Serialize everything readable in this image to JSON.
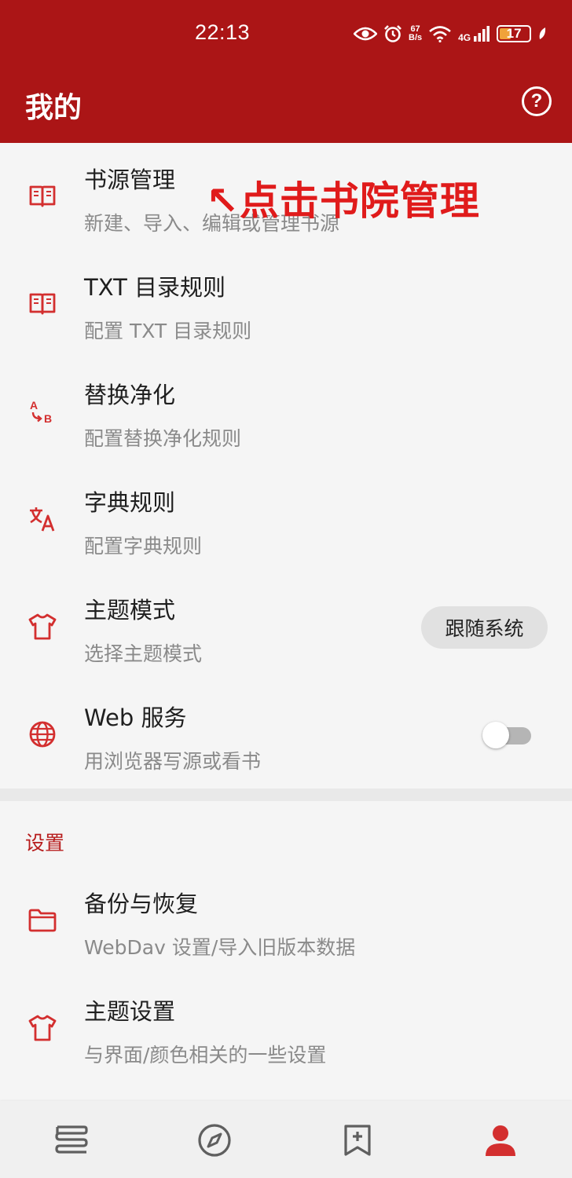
{
  "status_bar": {
    "time": "22:13",
    "net_speed_value": "67",
    "net_speed_unit": "B/s",
    "network_type": "4G",
    "battery_level": "17",
    "icons": [
      "eye-icon",
      "alarm-icon",
      "wifi-icon",
      "signal-icon",
      "battery-icon",
      "leaf-icon"
    ]
  },
  "app_bar": {
    "title": "我的",
    "help_icon": "question-circle-icon",
    "help_glyph": "?"
  },
  "colors": {
    "primary": "#ab1516",
    "accent": "#d32f2f",
    "annotation": "#e01b1b",
    "section_header": "#b71c1c",
    "background": "#f5f5f5"
  },
  "annotation": {
    "text": "↖点击书院管理"
  },
  "menu": {
    "items": [
      {
        "icon": "book-icon",
        "title": "书源管理",
        "summary": "新建、导入、编辑或管理书源"
      },
      {
        "icon": "book-icon",
        "title": "TXT 目录规则",
        "summary": "配置 TXT 目录规则"
      },
      {
        "icon": "replace-ab-icon",
        "title": "替换净化",
        "summary": "配置替换净化规则"
      },
      {
        "icon": "translate-icon",
        "title": "字典规则",
        "summary": "配置字典规则"
      },
      {
        "icon": "shirt-icon",
        "title": "主题模式",
        "summary": "选择主题模式",
        "value": "跟随系统"
      },
      {
        "icon": "globe-icon",
        "title": "Web 服务",
        "summary": "用浏览器写源或看书",
        "toggle": false
      }
    ]
  },
  "settings_section": {
    "header": "设置",
    "items": [
      {
        "icon": "folder-icon",
        "title": "备份与恢复",
        "summary": "WebDav 设置/导入旧版本数据"
      },
      {
        "icon": "shirt-icon",
        "title": "主题设置",
        "summary": "与界面/颜色相关的一些设置"
      }
    ]
  },
  "bottom_nav": {
    "items": [
      {
        "icon": "bookshelf-icon",
        "active": false
      },
      {
        "icon": "compass-icon",
        "active": false
      },
      {
        "icon": "bookmark-plus-icon",
        "active": false
      },
      {
        "icon": "person-icon",
        "active": true
      }
    ]
  }
}
